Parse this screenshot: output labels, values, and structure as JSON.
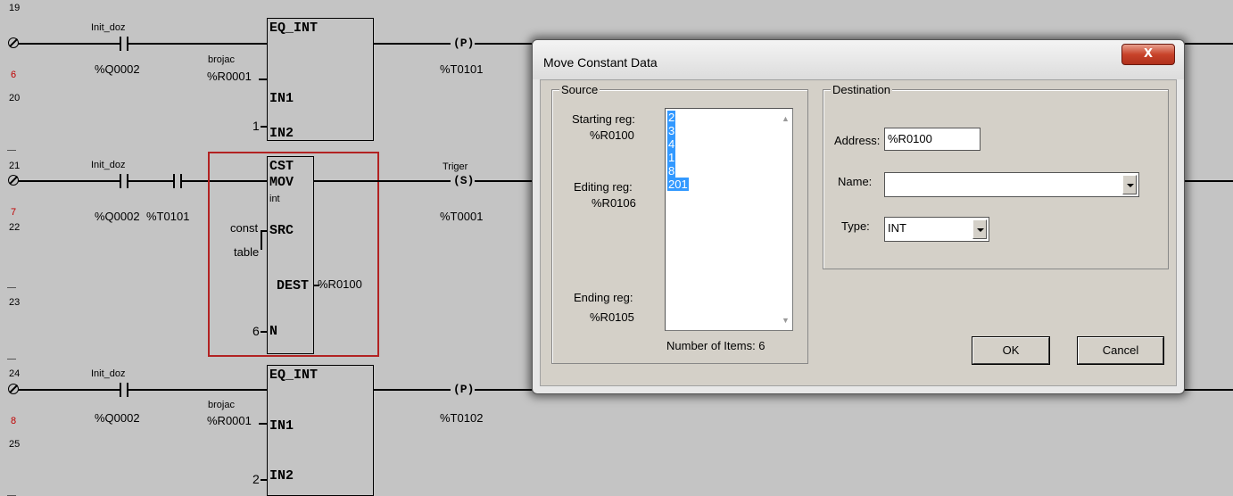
{
  "rungs": {
    "r19": {
      "line_numbers": [
        "19",
        "6",
        "20"
      ],
      "contact_label": "Init_doz",
      "contact_addr": "%Q0002",
      "block_name": "EQ_INT",
      "in1_var_name": "brojac",
      "in1_addr": "%R0001",
      "in1_pin": "IN1",
      "in2_value": "1",
      "in2_pin": "IN2",
      "coil_symbol": "(P)",
      "coil_addr": "%T0101"
    },
    "r21": {
      "line_numbers": [
        "21",
        "7",
        "22",
        "23"
      ],
      "contact1_label": "Init_doz",
      "contact1_addr": "%Q0002",
      "contact2_addr": "%T0101",
      "block_line1": "CST",
      "block_line2": "MOV",
      "block_type": "int",
      "src_label_1": "const",
      "src_label_2": "table",
      "src_pin": "SRC",
      "dest_pin": "DEST",
      "dest_addr": "%R0100",
      "n_value": "6",
      "n_pin": "N",
      "coil_label": "Triger",
      "coil_symbol": "(S)",
      "coil_addr": "%T0001"
    },
    "r24": {
      "line_numbers": [
        "24",
        "8",
        "25"
      ],
      "contact_label": "Init_doz",
      "contact_addr": "%Q0002",
      "block_name": "EQ_INT",
      "in1_var_name": "brojac",
      "in1_addr": "%R0001",
      "in1_pin": "IN1",
      "in2_value": "2",
      "in2_pin": "IN2",
      "coil_symbol": "(P)",
      "coil_addr": "%T0102"
    }
  },
  "dialog": {
    "title": "Move Constant Data",
    "close_label": "X",
    "source": {
      "group_label": "Source",
      "starting_label": "Starting reg:",
      "starting_addr": "%R0100",
      "editing_label": "Editing reg:",
      "editing_addr": "%R0106",
      "ending_label": "Ending reg:",
      "ending_addr": "%R0105",
      "items": [
        "2",
        "3",
        "4",
        "1",
        "8",
        "201"
      ],
      "count_text": "Number of Items: 6"
    },
    "destination": {
      "group_label": "Destination",
      "address_label": "Address:",
      "address_value": "%R0100",
      "name_label": "Name:",
      "name_value": "",
      "type_label": "Type:",
      "type_value": "INT"
    },
    "ok_label": "OK",
    "cancel_label": "Cancel"
  },
  "colors": {
    "background": "#c4c4c4",
    "selection": "#3399ff",
    "highlight_box": "#b22222",
    "close_button": "#c8432a"
  }
}
